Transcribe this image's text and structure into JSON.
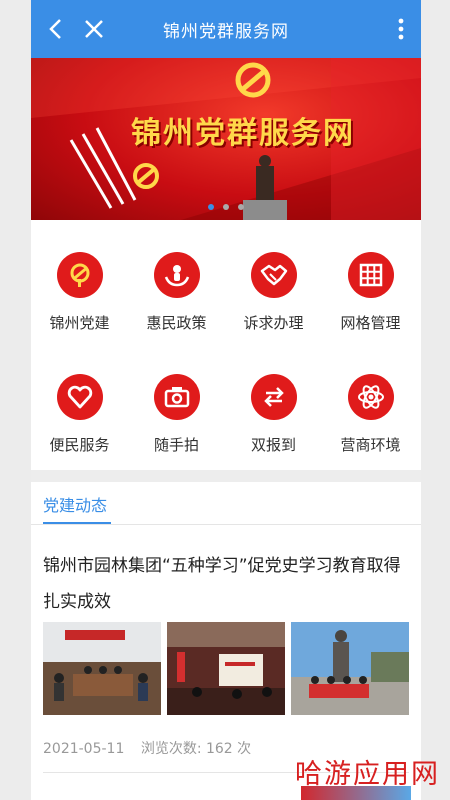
{
  "header": {
    "title": "锦州党群服务网",
    "back_icon": "chevron-left-icon",
    "close_icon": "close-icon",
    "more_icon": "more-vertical-icon"
  },
  "banner": {
    "title": "锦州党群服务网",
    "slide_index": 1,
    "slide_count": 3
  },
  "menu": {
    "items": [
      {
        "label": "锦州党建",
        "icon": "party-emblem-icon"
      },
      {
        "label": "惠民政策",
        "icon": "hands-person-icon"
      },
      {
        "label": "诉求办理",
        "icon": "handshake-icon"
      },
      {
        "label": "网格管理",
        "icon": "grid-icon"
      },
      {
        "label": "便民服务",
        "icon": "heart-icon"
      },
      {
        "label": "随手拍",
        "icon": "camera-icon"
      },
      {
        "label": "双报到",
        "icon": "swap-arrows-icon"
      },
      {
        "label": "营商环境",
        "icon": "atom-icon"
      }
    ]
  },
  "news": {
    "tab_label": "党建动态",
    "article": {
      "title": "锦州市园林集团“五种学习”促党史学习教育取得扎实成效",
      "date": "2021-05-11",
      "views_label": "浏览次数: 162 次"
    }
  },
  "watermark": "哈游应用网",
  "colors": {
    "accent": "#3a8ee6",
    "brand_red": "#e01b1b"
  }
}
